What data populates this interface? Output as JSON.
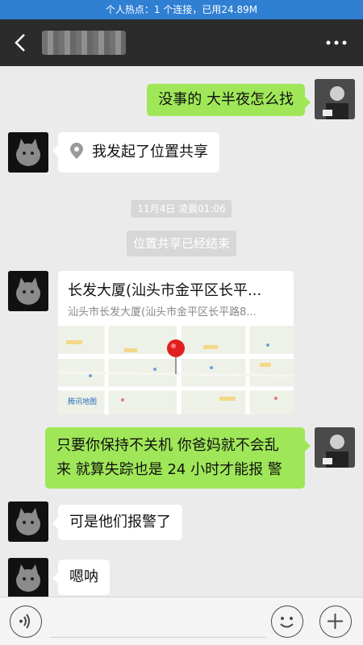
{
  "status_bar": {
    "text": "个人热点：1 个连接，已用24.89M"
  },
  "messages": [
    {
      "side": "right",
      "text": "没事的 大半夜怎么找"
    },
    {
      "side": "left",
      "text": "我发起了位置共享"
    },
    {
      "side": "left",
      "text": "可是他们报警了"
    },
    {
      "side": "left",
      "text": "嗯呐"
    }
  ],
  "long_message": {
    "line1": "只要你保持不关机 你爸妈就不会乱",
    "line2": "来 就算失踪也是 24 小时才能报  警"
  },
  "system": {
    "timestamp": "11月4日 凌晨01:06",
    "share_ended": "位置共享已经结束"
  },
  "location": {
    "title": "长发大厦(汕头市金平区长平...",
    "address": "汕头市长发大厦(汕头市金平区长平路8...",
    "map_logo": "腾讯地图"
  },
  "input": {
    "placeholder": ""
  }
}
